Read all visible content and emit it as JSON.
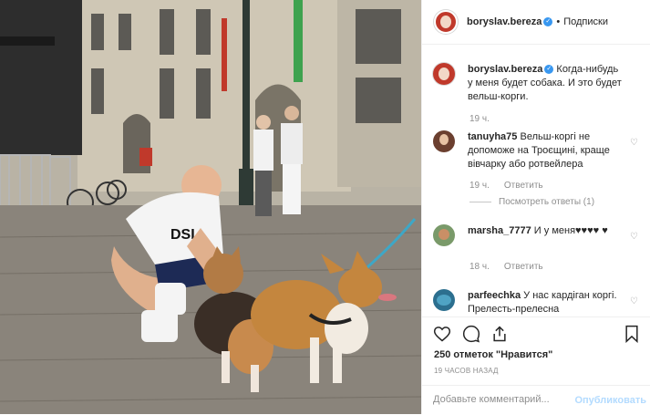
{
  "post": {
    "author": {
      "username": "boryslav.bereza",
      "verified": true,
      "follow_label": "Подписки",
      "separator": "•"
    },
    "caption": {
      "username": "boryslav.bereza",
      "text": "Когда-нибудь у меня будет собака. И это будет вельш-корги.",
      "time": "19 ч."
    },
    "comments": [
      {
        "username": "tanuyha75",
        "text": "Вельш-коргі не допоможе на Троєщині, краще вівчарку або ротвейлера",
        "time": "19 ч.",
        "reply_label": "Ответить",
        "view_replies": "Посмотреть ответы (1)"
      },
      {
        "username": "marsha_7777",
        "text": "И у меня♥♥♥♥ ♥",
        "time": "18 ч.",
        "reply_label": "Ответить"
      },
      {
        "username": "parfeechka",
        "text": "У нас кардіган коргі. Прелесть-прелесна"
      }
    ],
    "likes": "250 отметок \"Нравится\"",
    "timestamp": "19 ЧАСОВ НАЗАД",
    "composer": {
      "placeholder": "Добавьте комментарий...",
      "publish_label": "Опубликовать"
    },
    "icons": {
      "like": "heart-icon",
      "comment": "comment-icon",
      "share": "share-icon",
      "save": "bookmark-icon",
      "comment_like": "small-heart-icon"
    },
    "colors": {
      "verified": "#3897f0",
      "publish_disabled": "#b3dbff",
      "secondary_text": "#8e8e8e",
      "border": "#efefef"
    }
  }
}
